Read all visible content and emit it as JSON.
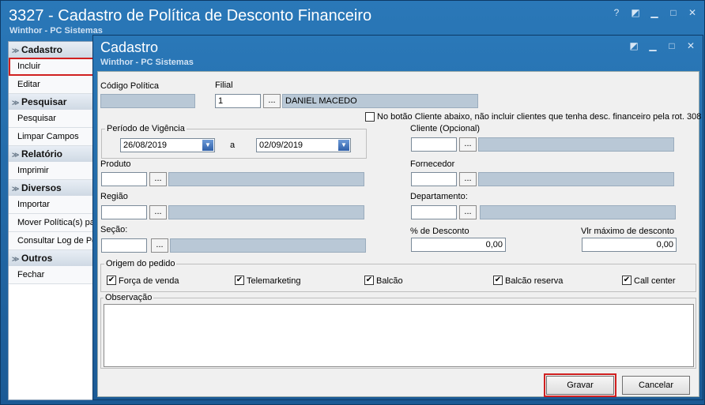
{
  "window": {
    "title": "3327 - Cadastro de Política de Desconto Financeiro",
    "subtitle": "Winthor - PC Sistemas"
  },
  "sidebar": {
    "sections": [
      {
        "label": "Cadastro",
        "items": [
          "Incluir",
          "Editar"
        ]
      },
      {
        "label": "Pesquisar",
        "items": [
          "Pesquisar",
          "Limpar Campos"
        ]
      },
      {
        "label": "Relatório",
        "items": [
          "Imprimir"
        ]
      },
      {
        "label": "Diversos",
        "items": [
          "Importar",
          "Mover Política(s) pa",
          "Consultar Log de Po"
        ]
      },
      {
        "label": "Outros",
        "items": [
          "Fechar"
        ]
      }
    ]
  },
  "dialog": {
    "title": "Cadastro",
    "subtitle": "Winthor - PC Sistemas"
  },
  "form": {
    "codigo_politica_label": "Código Política",
    "codigo_politica_value": "",
    "filial_label": "Filial",
    "filial_value": "1",
    "filial_name": "DANIEL MACEDO",
    "no_cliente_checkbox_label": "No botão Cliente abaixo, não incluir clientes que tenha desc. financeiro pela rot. 308",
    "periodo_label": "Período de Vigência",
    "data_inicio": "26/08/2019",
    "a_label": "a",
    "data_fim": "02/09/2019",
    "cliente_label": "Cliente (Opcional)",
    "produto_label": "Produto",
    "fornecedor_label": "Fornecedor",
    "regiao_label": "Região",
    "departamento_label": "Departamento:",
    "secao_label": "Seção:",
    "desconto_label": "% de Desconto",
    "desconto_value": "0,00",
    "vlr_max_label": "Vlr máximo de desconto",
    "vlr_max_value": "0,00",
    "origem_label": "Origem do pedido",
    "origens": [
      "Força de venda",
      "Telemarketing",
      "Balcão",
      "Balcão reserva",
      "Call center"
    ],
    "observacao_label": "Observação",
    "dots": "..."
  },
  "buttons": {
    "gravar": "Gravar",
    "cancelar": "Cancelar"
  },
  "colors": {
    "titlebar": "#1f68a8",
    "highlight": "#d02020",
    "readonly": "#b9c8d6"
  }
}
